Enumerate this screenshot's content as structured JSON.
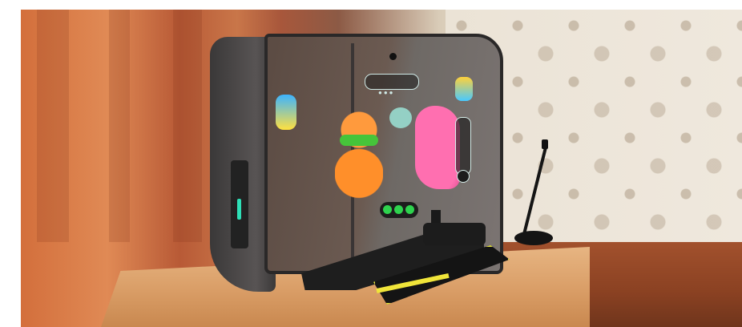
{
  "scene": {
    "subject": "",
    "visible_text": []
  }
}
